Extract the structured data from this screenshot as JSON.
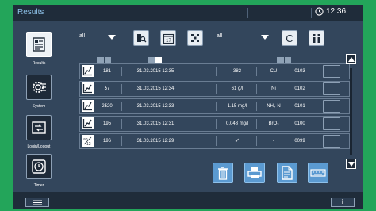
{
  "header": {
    "title": "Results",
    "time": "12:36"
  },
  "sidebar": {
    "items": [
      {
        "label": "Results",
        "icon": "results-icon",
        "active": true
      },
      {
        "label": "System",
        "icon": "system-gear-icon",
        "active": false
      },
      {
        "label": "Login/Logout",
        "icon": "login-logout-icon",
        "active": false
      },
      {
        "label": "Timer",
        "icon": "timer-icon",
        "active": false
      }
    ]
  },
  "filters": {
    "filter1_value": "all",
    "date_icon_text": "17",
    "filter2_value": "all",
    "clear_label": "C"
  },
  "table": {
    "rows": [
      {
        "icon": "measurement-icon",
        "number": "181",
        "datetime": "31.03.2015 12:35",
        "value": "382",
        "unit": "CU",
        "code": "0103"
      },
      {
        "icon": "measurement-icon",
        "number": "57",
        "datetime": "31.03.2015 12:34",
        "value": "61 g/l",
        "unit": "Ni",
        "code": "0102"
      },
      {
        "icon": "measurement-icon",
        "number": "2520",
        "datetime": "31.03.2015 12:33",
        "value": "1.15 mg/l",
        "unit": "NH₄-N",
        "code": "0101"
      },
      {
        "icon": "measurement-icon",
        "number": "195",
        "datetime": "31.03.2015 12:31",
        "value": "0.048 mg/l",
        "unit": "BrO₃",
        "code": "0100"
      },
      {
        "icon": "ab12-icon",
        "number": "196",
        "datetime": "31.03.2015 12:29",
        "value": "✓",
        "unit": "-",
        "code": "0099"
      }
    ]
  },
  "colors": {
    "background": "#23a55a",
    "screen": "#33465c",
    "accent": "#5b9ad1",
    "title": "#8fc3ea"
  }
}
